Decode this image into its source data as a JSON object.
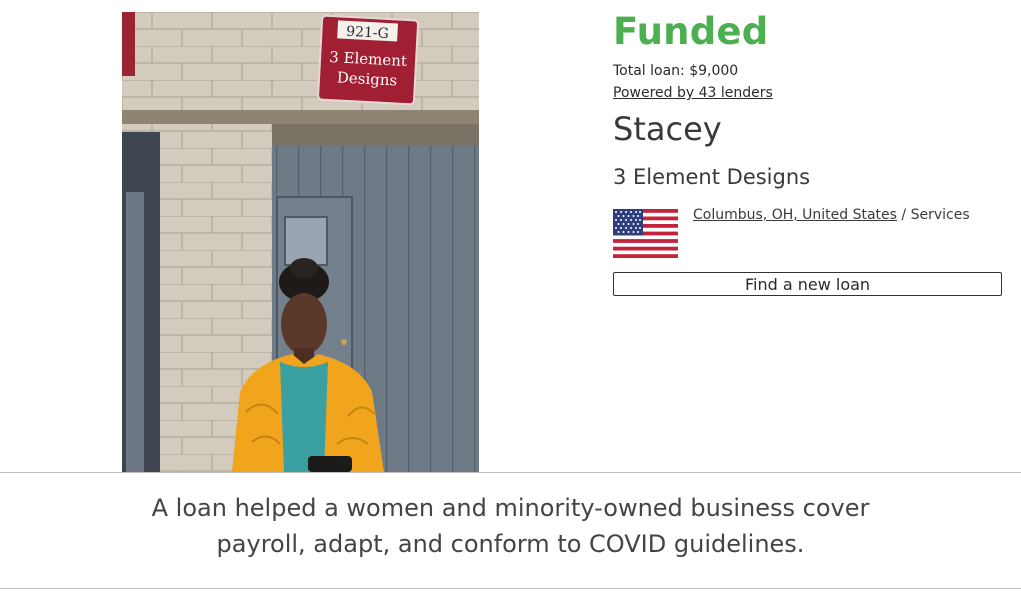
{
  "loan": {
    "status": "Funded",
    "total_loan": "Total loan: $9,000",
    "lenders_link": "Powered by 43 lenders",
    "borrower_name": "Stacey",
    "business_name": "3 Element Designs",
    "location": "Columbus, OH, United States",
    "separator": " / ",
    "sector": "Services",
    "find_button": "Find a new loan",
    "flag_icon": "us-flag-icon",
    "status_color": "#4caf50"
  },
  "photo": {
    "sign_number": "921-G",
    "sign_line1": "3 Element",
    "sign_line2": "Designs"
  },
  "story": {
    "line1": "A loan helped a women and minority-owned business cover",
    "line2": "payroll, adapt, and conform to COVID guidelines."
  }
}
